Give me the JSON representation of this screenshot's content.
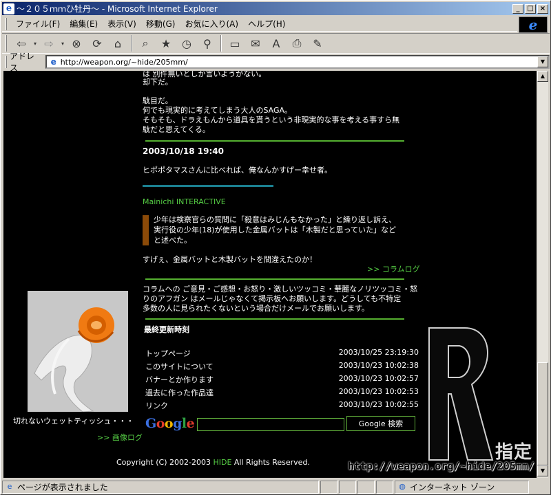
{
  "window": {
    "title": "～２０５ｍｍひ牡丹～ - Microsoft Internet Explorer",
    "minimize_label": "_",
    "maximize_label": "□",
    "close_label": "×"
  },
  "menubar": {
    "items": [
      "ファイル(F)",
      "編集(E)",
      "表示(V)",
      "移動(G)",
      "お気に入り(A)",
      "ヘルプ(H)"
    ]
  },
  "address": {
    "label": "アドレス",
    "url": "http://weapon.org/~hide/205mm/"
  },
  "content": {
    "top_partial": "は 別件無いとしか言いようがない。",
    "line_rejected": "却下だ。",
    "para1": [
      "駄目だ。",
      "何でも現実的に考えてしまう大人のSAGA。",
      "そもそも、ドラえもんから道具を貰うという非現実的な事を考える事すら無",
      "駄だと思えてくる。"
    ],
    "entry_date": "2003/10/18 19:40",
    "entry_text": "ヒポポタマスさんに比べれば、俺なんかすげー幸せ者。",
    "source_link": "Mainichi INTERACTIVE",
    "quote": [
      "少年は検察官らの質問に「殺意はみじんもなかった」と繰り返し訴え、",
      "実行役の少年(18)が使用した金属バットは「木製だと思っていた」など",
      "と述べた。"
    ],
    "comment": "すげぇ、金属バットと木製バットを間違えたのか！",
    "column_log_link": ">> コラムログ",
    "notice": [
      "コラムへの ご意見・ご感想・お怒り・激しいツッコミ・華麗なノリツッコミ・怒",
      "りのアフガン はメールじゃなくて掲示板へお願いします。どうしても不特定",
      "多数の人に見られたくないという場合だけメールでお願いします。"
    ],
    "updates_title": "最終更新時刻",
    "updates": [
      {
        "name": "トップページ",
        "date": "2003/10/25 23:19:30"
      },
      {
        "name": "このサイトについて",
        "date": "2003/10/23 10:02:38"
      },
      {
        "name": "バナーとか作ります",
        "date": "2003/10/23 10:02:57"
      },
      {
        "name": "過去に作った作品達",
        "date": "2003/10/23 10:02:53"
      },
      {
        "name": "リンク",
        "date": "2003/10/23 10:02:55"
      }
    ],
    "google_logo": "Google",
    "google_button": "Google 検索",
    "thumb_caption": "切れないウェットティッシュ・・・",
    "image_log_link": ">> 画像ログ",
    "copyright_prefix": "Copyright (C) 2002-2003 ",
    "copyright_name": "HIDE",
    "copyright_suffix": " All Rights Reserved.",
    "banner_letter": "R",
    "banner_text": "指定",
    "banner_url": "http://weapon.org/~hide/205mm/"
  },
  "status": {
    "text": "ページが表示されました",
    "zone": "インターネット ゾーン"
  },
  "colors": {
    "accent_green": "#55cc44",
    "teal": "#1b7f8f",
    "quote_bar": "#8b4a08"
  }
}
